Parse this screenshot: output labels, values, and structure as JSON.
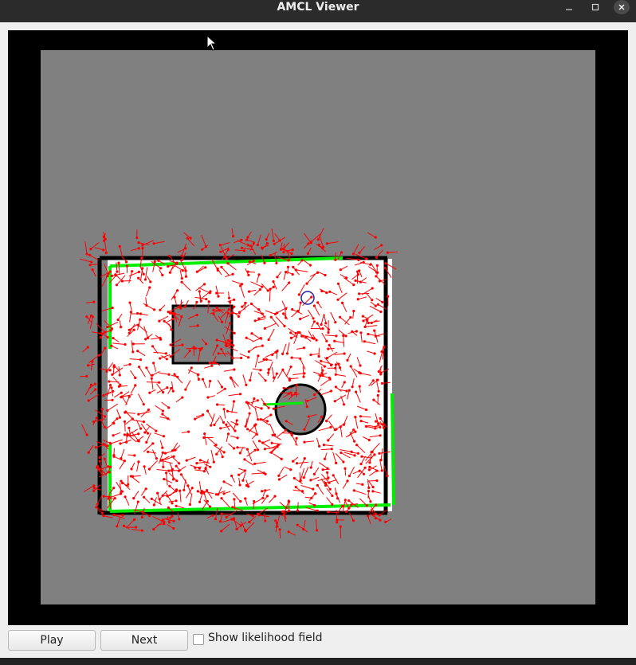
{
  "window": {
    "title": "AMCL Viewer"
  },
  "window_controls": {
    "minimize": "minimize-icon",
    "maximize": "maximize-icon",
    "close": "close-icon"
  },
  "viewer": {
    "map": {
      "background_color": "#808080",
      "free_space_color": "#ffffff",
      "wall_color": "#000000",
      "particle_color": "#ff0000",
      "scan_color": "#00ee00",
      "pose_marker_color": "#2222aa"
    }
  },
  "controls": {
    "play_label": "Play",
    "next_label": "Next",
    "likelihood_label": "Show likelihood field",
    "likelihood_checked": false
  }
}
